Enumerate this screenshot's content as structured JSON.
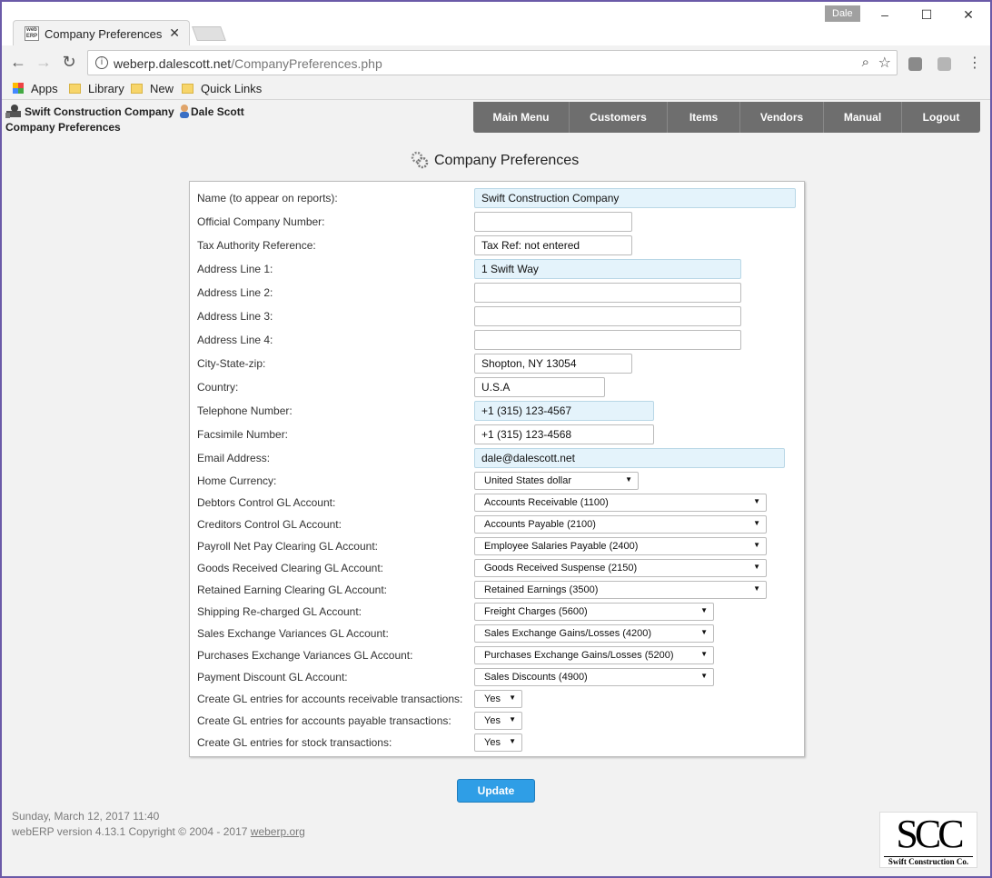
{
  "browser": {
    "tab_title": "Company Preferences",
    "tab_favicon_text": "web ERP",
    "profile_name": "Dale",
    "url_host": "weberp.dalescott.net",
    "url_path": "/CompanyPreferences.php",
    "bookmarks": [
      "Apps",
      "Library",
      "New",
      "Quick Links"
    ]
  },
  "header": {
    "company": "Swift Construction Company",
    "user": "Dale Scott",
    "page_label": "Company Preferences",
    "nav": [
      "Main Menu",
      "Customers",
      "Items",
      "Vendors",
      "Manual",
      "Logout"
    ]
  },
  "page": {
    "heading": "Company Preferences"
  },
  "form": {
    "fields": [
      {
        "label": "Name (to appear on reports):",
        "value": "Swift Construction Company"
      },
      {
        "label": "Official Company Number:",
        "value": ""
      },
      {
        "label": "Tax Authority Reference:",
        "value": "Tax Ref: not entered"
      },
      {
        "label": "Address Line 1:",
        "value": "1 Swift Way"
      },
      {
        "label": "Address Line 2:",
        "value": ""
      },
      {
        "label": "Address Line 3:",
        "value": ""
      },
      {
        "label": "Address Line 4:",
        "value": ""
      },
      {
        "label": "City-State-zip:",
        "value": "Shopton, NY 13054"
      },
      {
        "label": "Country:",
        "value": "U.S.A"
      },
      {
        "label": "Telephone Number:",
        "value": "+1 (315) 123-4567"
      },
      {
        "label": "Facsimile Number:",
        "value": "+1 (315) 123-4568"
      },
      {
        "label": "Email Address:",
        "value": "dale@dalescott.net"
      }
    ],
    "selects": [
      {
        "label": "Home Currency:",
        "value": "United States dollar"
      },
      {
        "label": "Debtors Control GL Account:",
        "value": "Accounts Receivable (1100)"
      },
      {
        "label": "Creditors Control GL Account:",
        "value": "Accounts Payable (2100)"
      },
      {
        "label": "Payroll Net Pay Clearing GL Account:",
        "value": "Employee Salaries Payable (2400)"
      },
      {
        "label": "Goods Received Clearing GL Account:",
        "value": "Goods Received Suspense (2150)"
      },
      {
        "label": "Retained Earning Clearing GL Account:",
        "value": "Retained Earnings (3500)"
      },
      {
        "label": "Shipping Re-charged GL Account:",
        "value": "Freight Charges (5600)"
      },
      {
        "label": "Sales Exchange Variances GL Account:",
        "value": "Sales Exchange Gains/Losses (4200)"
      },
      {
        "label": "Purchases Exchange Variances GL Account:",
        "value": "Purchases Exchange Gains/Losses (5200)"
      },
      {
        "label": "Payment Discount GL Account:",
        "value": "Sales Discounts (4900)"
      },
      {
        "label": "Create GL entries for accounts receivable transactions:",
        "value": "Yes"
      },
      {
        "label": "Create GL entries for accounts payable transactions:",
        "value": "Yes"
      },
      {
        "label": "Create GL entries for stock transactions:",
        "value": "Yes"
      }
    ],
    "update_label": "Update"
  },
  "footer": {
    "date": "Sunday, March 12, 2017 11:40",
    "version": "webERP version 4.13.1 Copyright © 2004 - 2017 ",
    "link": "weberp.org",
    "logo_big": "SCC",
    "logo_small": "Swift Construction Co."
  },
  "colors": {
    "nav_bg": "#6e6e6e",
    "highlight_field": "#e4f3fb",
    "update_button": "#2f9ee6"
  }
}
